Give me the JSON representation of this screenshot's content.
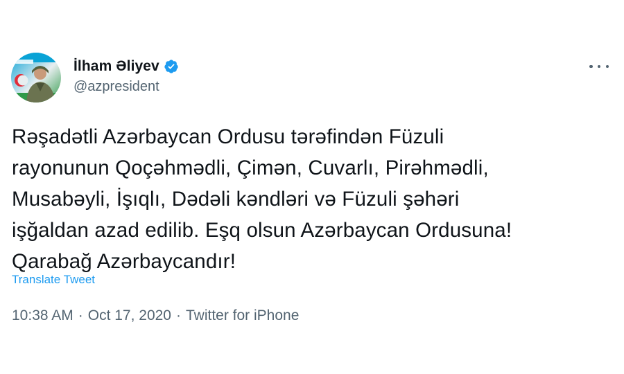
{
  "author": {
    "display_name": "İlham Əliyev",
    "handle": "@azpresident",
    "verified": true,
    "avatar_icon": "profile-photo-avatar"
  },
  "tweet": {
    "lines": [
      "Rəşadətli Azərbaycan Ordusu tərəfindən Füzuli",
      "rayonunun Qoçəhmədli, Çimən, Cuvarlı, Pirəhmədli,",
      "Musabəyli, İşıqlı, Dədəli kəndləri və Füzuli şəhəri",
      "işğaldan azad edilib. Eşq olsun Azərbaycan Ordusuna!",
      "Qarabağ Azərbaycandır!"
    ]
  },
  "actions": {
    "translate_label": "Translate Tweet",
    "more_icon": "more-horizontal-icon"
  },
  "meta": {
    "time": "10:38 AM",
    "date": "Oct 17, 2020",
    "source": "Twitter for iPhone",
    "separator": "·"
  },
  "colors": {
    "accent": "#1d9bf0",
    "text": "#0f1419",
    "secondary": "#536471"
  }
}
